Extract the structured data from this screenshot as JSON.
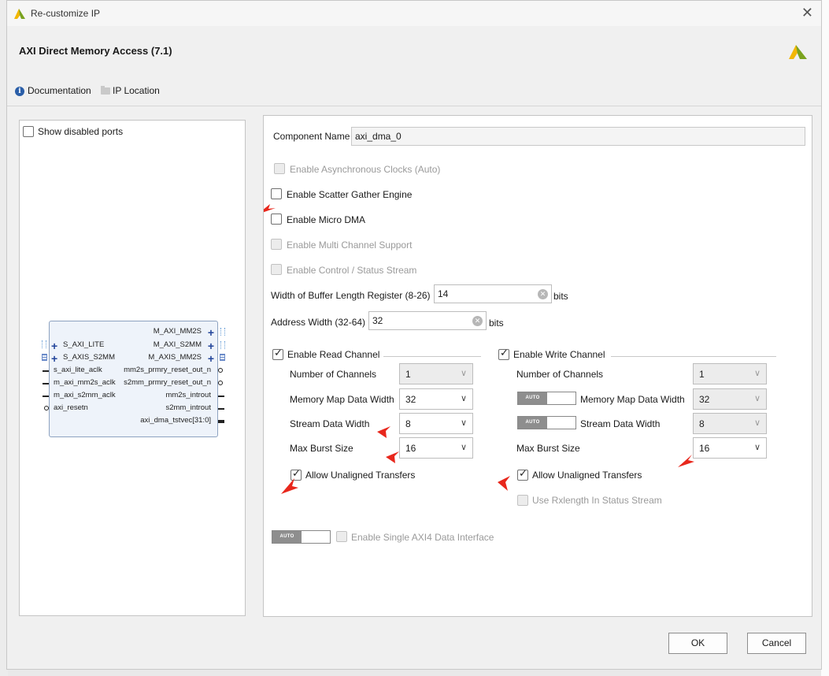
{
  "window": {
    "title": "Re-customize IP"
  },
  "header": {
    "ip_title": "AXI Direct Memory Access (7.1)"
  },
  "links": {
    "documentation": "Documentation",
    "ip_location": "IP Location"
  },
  "left_pane": {
    "show_disabled_ports": {
      "label": "Show disabled ports",
      "checked": false
    },
    "block": {
      "left_ports": [
        "S_AXI_LITE",
        "S_AXIS_S2MM",
        "s_axi_lite_aclk",
        "m_axi_mm2s_aclk",
        "m_axi_s2mm_aclk",
        "axi_resetn"
      ],
      "right_ports": [
        "M_AXI_MM2S",
        "M_AXI_S2MM",
        "M_AXIS_MM2S",
        "mm2s_prmry_reset_out_n",
        "s2mm_prmry_reset_out_n",
        "mm2s_introut",
        "s2mm_introut",
        "axi_dma_tstvec[31:0]"
      ]
    }
  },
  "config": {
    "component_name_label": "Component Name",
    "component_name_value": "axi_dma_0",
    "enable_async_clocks": {
      "label": "Enable Asynchronous Clocks (Auto)",
      "checked": false,
      "enabled": false
    },
    "enable_sg": {
      "label": "Enable Scatter Gather Engine",
      "checked": false,
      "enabled": true
    },
    "enable_micro_dma": {
      "label": "Enable Micro DMA",
      "checked": false,
      "enabled": true
    },
    "enable_multichannel": {
      "label": "Enable Multi Channel Support",
      "checked": false,
      "enabled": false
    },
    "enable_ctrl_status": {
      "label": "Enable Control / Status Stream",
      "checked": false,
      "enabled": false
    },
    "buffer_len": {
      "label": "Width of Buffer Length Register (8-26)",
      "value": "14",
      "unit": "bits"
    },
    "addr_width": {
      "label": "Address Width (32-64)",
      "value": "32",
      "unit": "bits"
    },
    "read_channel": {
      "label": "Enable Read Channel",
      "checked": true,
      "num_channels": {
        "label": "Number of Channels",
        "value": "1"
      },
      "mm_data_width": {
        "label": "Memory Map Data Width",
        "value": "32"
      },
      "stream_data_width": {
        "label": "Stream Data Width",
        "value": "8"
      },
      "max_burst": {
        "label": "Max Burst Size",
        "value": "16"
      },
      "allow_unaligned": {
        "label": "Allow Unaligned Transfers",
        "checked": true
      }
    },
    "write_channel": {
      "label": "Enable Write Channel",
      "checked": true,
      "num_channels": {
        "label": "Number of Channels",
        "value": "1"
      },
      "mm_data_width": {
        "label": "Memory Map Data Width",
        "value": "32"
      },
      "stream_data_width": {
        "label": "Stream Data Width",
        "value": "8"
      },
      "max_burst": {
        "label": "Max Burst Size",
        "value": "16"
      },
      "allow_unaligned": {
        "label": "Allow Unaligned Transfers",
        "checked": true
      },
      "use_rxlength": {
        "label": "Use Rxlength In Status Stream",
        "checked": false,
        "enabled": false
      }
    },
    "auto_label": "AUTO",
    "single_axi4": {
      "label": "Enable Single AXI4 Data Interface",
      "checked": false,
      "enabled": false
    }
  },
  "buttons": {
    "ok": "OK",
    "cancel": "Cancel"
  },
  "colors": {
    "accent_arrow": "#e8271c",
    "logo_green": "#7aa21e",
    "logo_yellow": "#f2b705"
  }
}
